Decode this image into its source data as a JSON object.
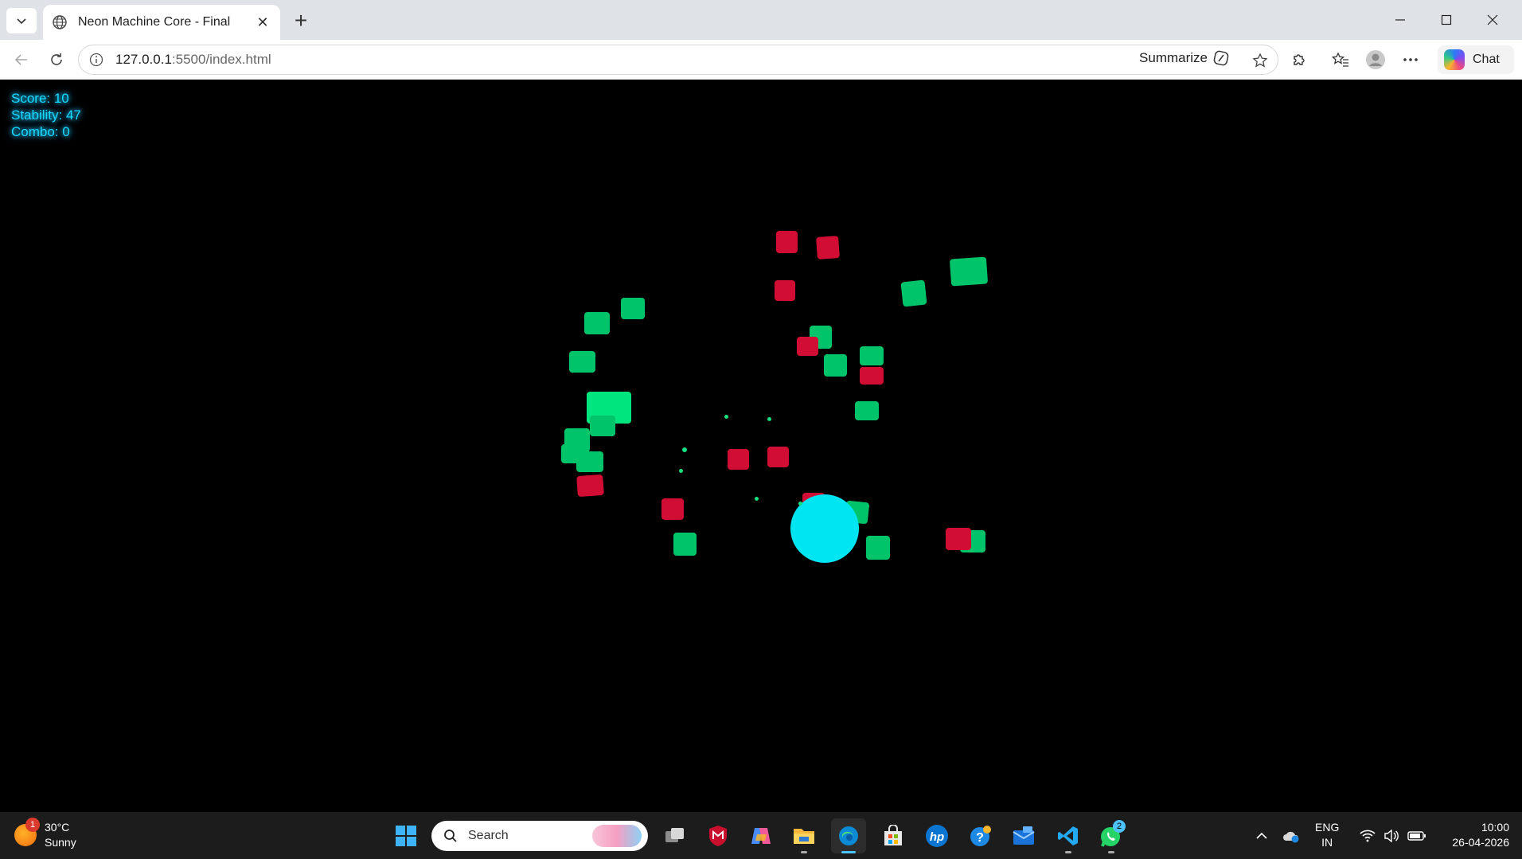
{
  "browser": {
    "tab_title": "Neon Machine Core - Final",
    "url_host": "127.0.0.1",
    "url_rest": ":5500/index.html",
    "summarize_label": "Summarize",
    "chat_label": "Chat"
  },
  "hud": {
    "score": "Score: 10",
    "stability": "Stability: 47",
    "combo": "Combo: 0"
  },
  "taskbar": {
    "weather_temp": "30°C",
    "weather_desc": "Sunny",
    "weather_badge": "1",
    "search_placeholder": "Search",
    "whatsapp_badge": "2",
    "lang_top": "ENG",
    "lang_bottom": "IN",
    "time": "10:00",
    "date": "26-04-2026"
  },
  "colors": {
    "hud_text": "#19d9ff",
    "core": "#00e5f2",
    "green_block": "#00c46a",
    "red_block": "#d10d33"
  }
}
